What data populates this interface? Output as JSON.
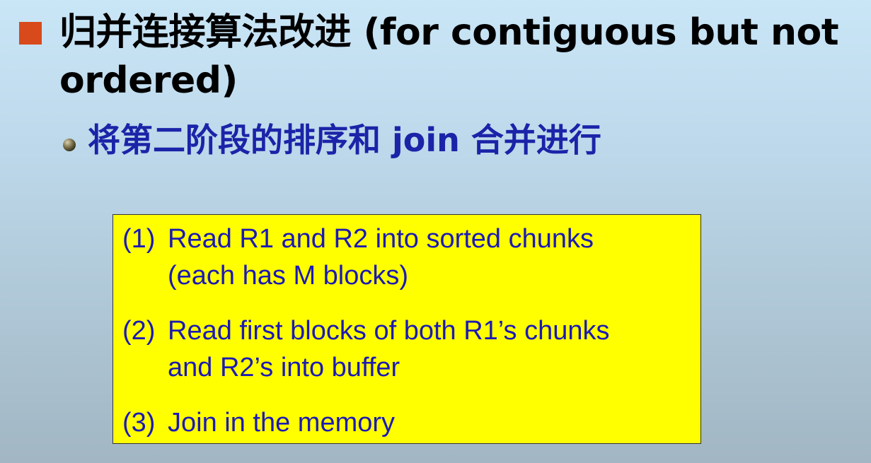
{
  "title": "归并连接算法改进 (for contiguous but not ordered)",
  "subtitle": "将第二阶段的排序和 join 合并进行",
  "steps": [
    {
      "number": "(1)",
      "line1": "Read R1 and R2 into sorted chunks",
      "line2": "(each has M blocks)"
    },
    {
      "number": "(2)",
      "line1": "Read first blocks of both R1’s chunks",
      "line2": "and R2’s into buffer"
    },
    {
      "number": "(3)",
      "line1": "Join in the memory",
      "line2": ""
    }
  ],
  "icons": {
    "title_bullet": "square-bullet-icon",
    "subtitle_bullet": "round-bullet-icon"
  },
  "colors": {
    "title_bullet": "#d84a1b",
    "subtitle_text": "#1a24a8",
    "box_background": "#ffff00",
    "box_text": "#1c1ab4"
  }
}
